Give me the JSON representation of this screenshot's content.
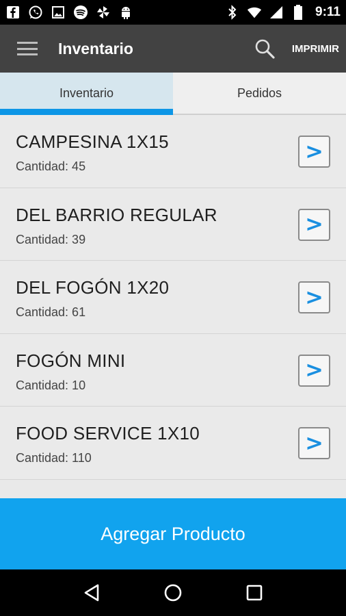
{
  "status_bar": {
    "time": "9:11",
    "left_icons": [
      "facebook-icon",
      "whatsapp-icon",
      "image-icon",
      "spotify-icon",
      "pinwheel-icon",
      "android-icon"
    ],
    "right_icons": [
      "bluetooth-icon",
      "wifi-icon",
      "signal-icon",
      "battery-icon"
    ]
  },
  "app_bar": {
    "title": "Inventario",
    "print_label": "IMPRIMIR",
    "search_icon": "search-icon",
    "menu_icon": "menu-icon"
  },
  "tabs": [
    {
      "label": "Inventario",
      "active": true
    },
    {
      "label": "Pedidos",
      "active": false
    }
  ],
  "inventory": [
    {
      "name": "CAMPESINA 1X15",
      "quantity": "Cantidad: 45"
    },
    {
      "name": "DEL BARRIO REGULAR",
      "quantity": "Cantidad: 39"
    },
    {
      "name": "DEL FOGÓN 1X20",
      "quantity": "Cantidad: 61"
    },
    {
      "name": "FOGÓN MINI",
      "quantity": "Cantidad: 10"
    },
    {
      "name": "FOOD SERVICE 1X10",
      "quantity": "Cantidad: 110"
    }
  ],
  "arrow_glyph": ">",
  "add_button_label": "Agregar Producto",
  "nav_bar": [
    "back-icon",
    "home-icon",
    "recents-icon"
  ],
  "colors": {
    "accent": "#11a3ee",
    "tab_indicator": "#0d96e6",
    "app_bar": "#424242",
    "arrow": "#1a8fe0"
  }
}
